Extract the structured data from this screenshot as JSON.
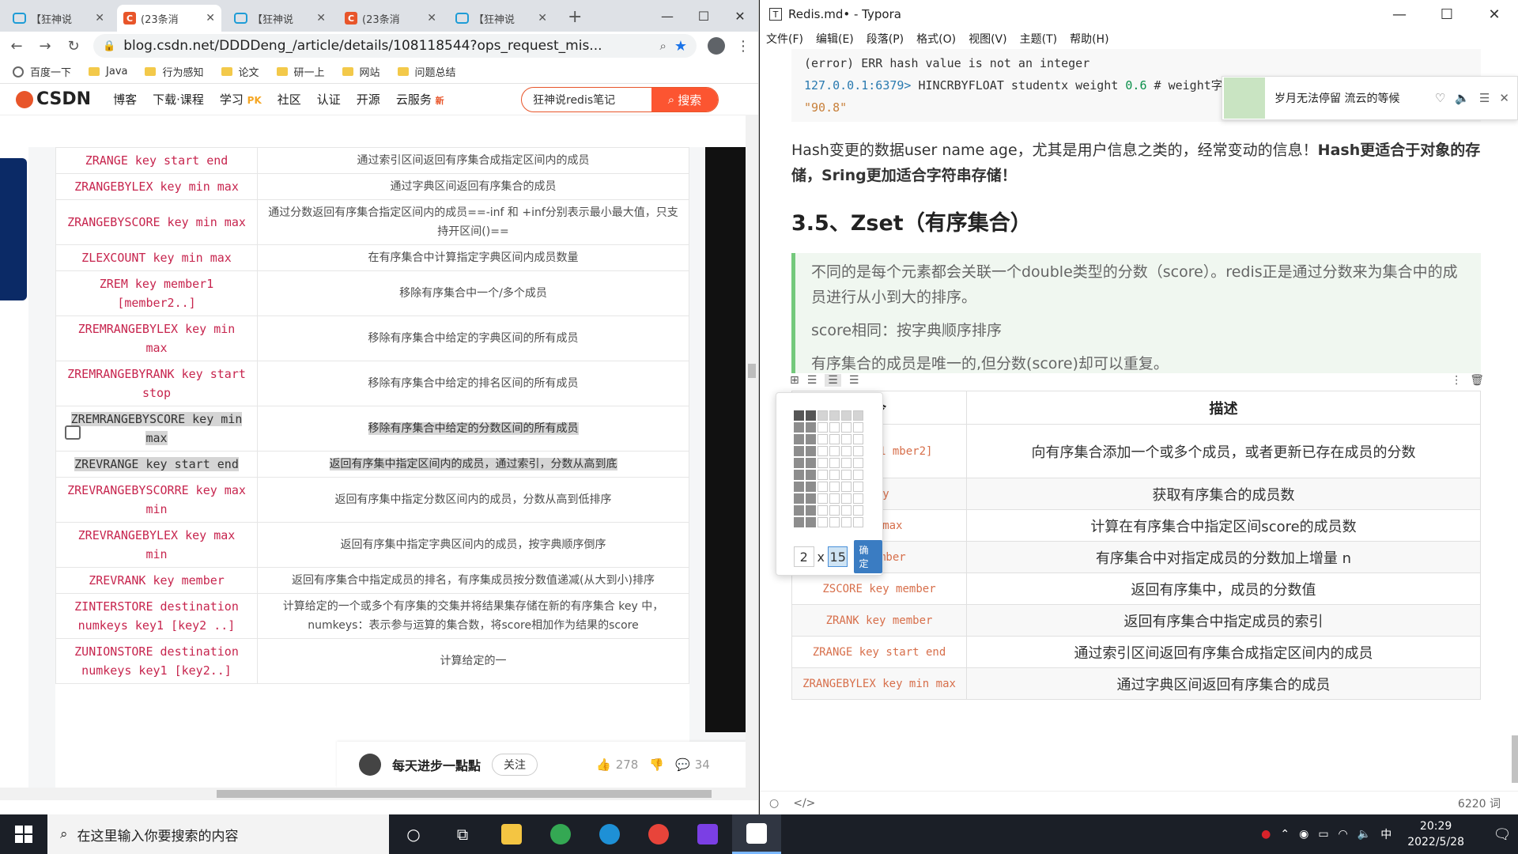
{
  "chrome": {
    "tabs": [
      {
        "label": "【狂神说",
        "type": "bili",
        "active": false
      },
      {
        "label": "(23条消",
        "type": "csdn",
        "active": true
      },
      {
        "label": "【狂神说",
        "type": "bili",
        "active": false
      },
      {
        "label": "(23条消",
        "type": "csdn",
        "active": false
      },
      {
        "label": "【狂神说",
        "type": "bili",
        "active": false
      }
    ],
    "url": "blog.csdn.net/DDDDeng_/article/details/108118544?ops_request_mis...",
    "bookmarks": [
      "百度一下",
      "Java",
      "行为感知",
      "论文",
      "研一上",
      "网站",
      "问题总结"
    ]
  },
  "csdn": {
    "logo": "CSDN",
    "nav": [
      "博客",
      "下载·课程",
      "学习",
      "社区",
      "认证",
      "开源",
      "云服务"
    ],
    "pk_badge": "PK",
    "new_badge": "新",
    "search_query": "狂神说redis笔记",
    "search_button": "搜索",
    "rows": [
      {
        "cmd": "ZRANGE key start end",
        "desc": "通过索引区间返回有序集合成指定区间内的成员"
      },
      {
        "cmd": "ZRANGEBYLEX key min max",
        "desc": "通过字典区间返回有序集合的成员"
      },
      {
        "cmd": "ZRANGEBYSCORE key min max",
        "desc": "通过分数返回有序集合指定区间内的成员==-inf 和 +inf分别表示最小最大值，只支持开区间()=="
      },
      {
        "cmd": "ZLEXCOUNT key min max",
        "desc": "在有序集合中计算指定字典区间内成员数量"
      },
      {
        "cmd": "ZREM key member1 [member2..]",
        "desc": "移除有序集合中一个/多个成员"
      },
      {
        "cmd": "ZREMRANGEBYLEX key min max",
        "desc": "移除有序集合中给定的字典区间的所有成员"
      },
      {
        "cmd": "ZREMRANGEBYRANK key start stop",
        "desc": "移除有序集合中给定的排名区间的所有成员"
      },
      {
        "cmd": "ZREMRANGEBYSCORE key min max",
        "desc": "移除有序集合中给定的分数区间的所有成员"
      },
      {
        "cmd": "ZREVRANGE key start end",
        "desc": "返回有序集中指定区间内的成员，通过索引，分数从高到底"
      },
      {
        "cmd": "ZREVRANGEBYSCORRE key max min",
        "desc": "返回有序集中指定分数区间内的成员，分数从高到低排序"
      },
      {
        "cmd": "ZREVRANGEBYLEX key max min",
        "desc": "返回有序集中指定字典区间内的成员，按字典顺序倒序"
      },
      {
        "cmd": "ZREVRANK key member",
        "desc": "返回有序集合中指定成员的排名，有序集成员按分数值递减(从大到小)排序"
      },
      {
        "cmd": "ZINTERSTORE destination numkeys key1 [key2 ..]",
        "desc": "计算给定的一个或多个有序集的交集并将结果集存储在新的有序集合 key 中，numkeys：表示参与运算的集合数，将score相加作为结果的score"
      },
      {
        "cmd": "ZUNIONSTORE destination numkeys key1 [key2..]",
        "desc": "计算给定的一"
      }
    ],
    "author": {
      "name": "每天进步一點點",
      "follow": "关注",
      "likes": "278",
      "comments": "34"
    }
  },
  "typora": {
    "title": "Redis.md• - Typora",
    "menu": [
      "文件(F)",
      "编辑(E)",
      "段落(P)",
      "格式(O)",
      "视图(V)",
      "主题(T)",
      "帮助(H)"
    ],
    "code_line1": "(error) ERR hash value is not an integer",
    "code_prompt": "127.0.0.1:6379>",
    "code_cmd": " HINCRBYFLOAT studentx weight ",
    "code_num": "0.6",
    "code_comment": " # weight字",
    "code_result": "\"90.8\"",
    "notification": "岁月无法停留 流云的等候",
    "para_normal": "Hash变更的数据user name age，尤其是用户信息之类的，经常变动的信息！",
    "para_bold": "Hash更适合于对象的存储，Sring更加适合字符串存储！",
    "heading": "3.5、Zset（有序集合）",
    "quote": [
      "不同的是每个元素都会关联一个double类型的分数（score）。redis正是通过分数来为集合中的成员进行从小到大的排序。",
      "score相同：按字典顺序排序",
      "有序集合的成员是唯一的,但分数(score)却可以重复。"
    ],
    "table_header_desc": "描述",
    "table_header_cmd_partial": "令",
    "table_rows": [
      {
        "cmd": "e member1 mber2]",
        "desc": "向有序集合添加一个或多个成员，或者更新已存在成员的分数"
      },
      {
        "cmd": "key",
        "desc": "获取有序集合的成员数"
      },
      {
        "cmd": "min max",
        "desc": "计算在有序集合中指定区间score的成员数"
      },
      {
        "cmd": "n member",
        "desc": "有序集合中对指定成员的分数加上增量 n"
      },
      {
        "cmd": "ZSCORE key member",
        "desc": "返回有序集中，成员的分数值"
      },
      {
        "cmd": "ZRANK key member",
        "desc": "返回有序集合中指定成员的索引"
      },
      {
        "cmd": "ZRANGE key start end",
        "desc": "通过索引区间返回有序集合成指定区间内的成员"
      },
      {
        "cmd": "ZRANGEBYLEX key min max",
        "desc": "通过字典区间返回有序集合的成员"
      }
    ],
    "grid_popup": {
      "cols": "2",
      "rows": "15",
      "x": "x",
      "confirm": "确定"
    },
    "word_count": "6220 词"
  },
  "taskbar": {
    "search_placeholder": "在这里输入你要搜索的内容",
    "ime": "中",
    "time": "20:29",
    "date": "2022/5/28"
  }
}
